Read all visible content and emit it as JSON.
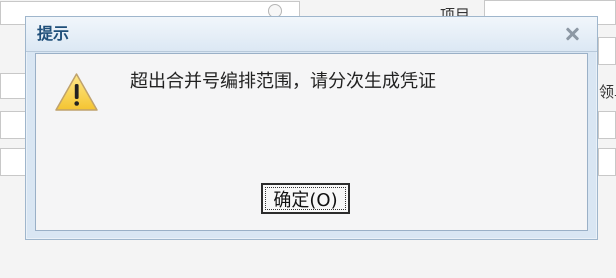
{
  "background": {
    "labels": {
      "project": "项目",
      "voucher_partial": "领单"
    }
  },
  "dialog": {
    "title": "提示",
    "message": "超出合并号编排范围，请分次生成凭证",
    "buttons": {
      "ok": "确定(O)"
    },
    "icons": {
      "close": "close-icon",
      "warning": "warning-icon"
    }
  }
}
